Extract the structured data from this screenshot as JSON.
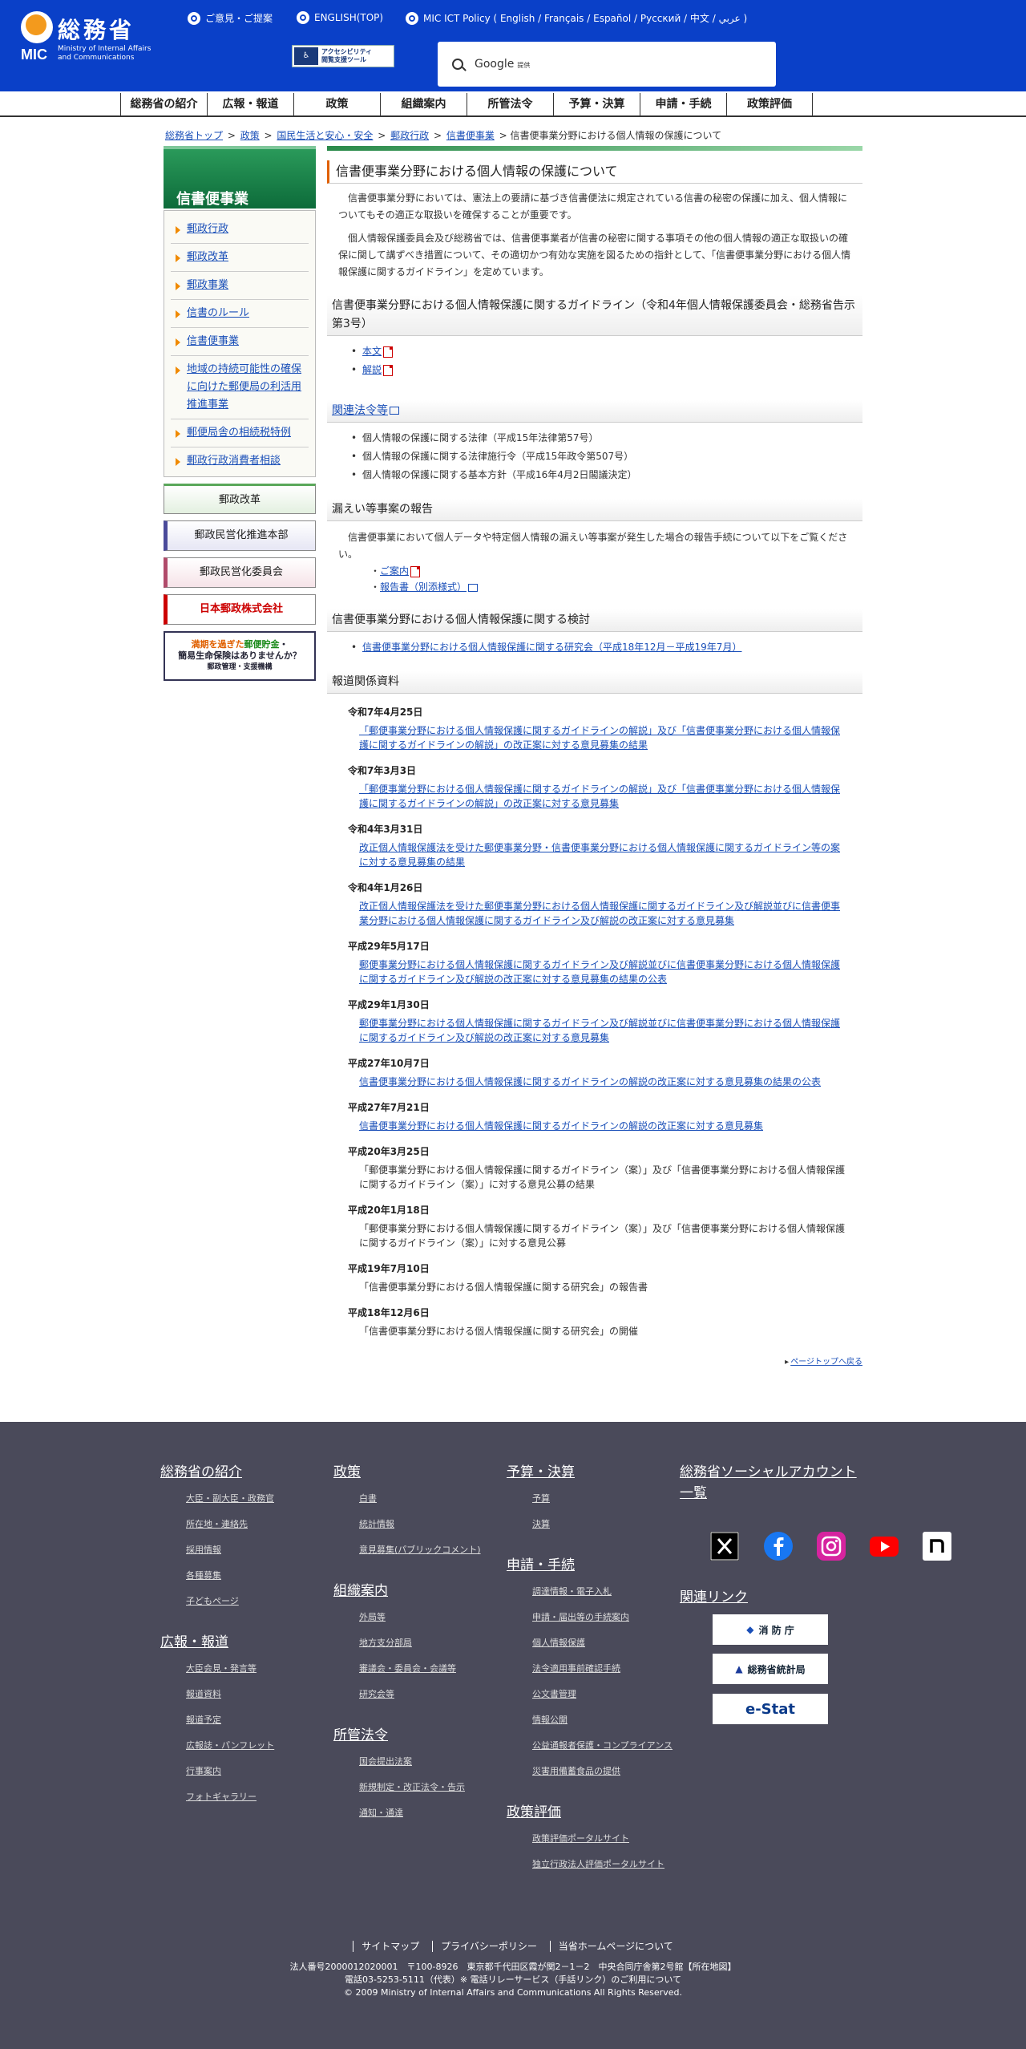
{
  "header": {
    "logo_kanji": "総務省",
    "logo_mic": "MIC",
    "logo_en1": "Ministry of Internal Affairs",
    "logo_en2": "and Communications",
    "links": [
      "ご意見・ご提案",
      "ENGLISH(TOP)",
      "MIC ICT Policy ( English / Français / Español / Русский / 中文 / عربي )"
    ],
    "accessibility_line1": "アクセシビリティ",
    "accessibility_line2": "閲覧支援ツール",
    "search_brand": "Google",
    "search_sub": "提供"
  },
  "gnav": [
    "総務省の紹介",
    "広報・報道",
    "政策",
    "組織案内",
    "所管法令",
    "予算・決算",
    "申請・手続",
    "政策評価"
  ],
  "breadcrumb": {
    "items": [
      "総務省トップ",
      "政策",
      "国民生活と安心・安全",
      "郵政行政",
      "信書便事業"
    ],
    "current": "信書便事業分野における個人情報の保護について"
  },
  "sidebar": {
    "title": "信書便事業",
    "items": [
      "郵政行政",
      "郵政改革",
      "郵政事業",
      "信書のルール",
      "信書便事業",
      "地域の持続可能性の確保に向けた郵便局の利活用推進事業",
      "郵便局舎の相続税特例",
      "郵政行政消費者相談"
    ],
    "buttons": [
      "郵政改革",
      "郵政民営化推進本部",
      "郵政民営化委員会",
      "日本郵政株式会社"
    ],
    "banner": {
      "l1a": "満期を過ぎた",
      "l1b": "郵便貯金",
      "l1c": "・",
      "l2": "簡易生命保険はありませんか？",
      "l3": "郵政管理・支援機構"
    }
  },
  "main": {
    "title": "信書便事業分野における個人情報の保護について",
    "p1": "信書便事業分野においては、憲法上の要請に基づき信書便法に規定されている信書の秘密の保護に加え、個人情報についてもその適正な取扱いを確保することが重要です。",
    "p2": "個人情報保護委員会及び総務省では、信書便事業者が信書の秘密に関する事項その他の個人情報の適正な取扱いの確保に関して講ずべき措置について、その適切かつ有効な実施を図るための指針として、「信書便事業分野における個人情報保護に関するガイドライン」を定めています。",
    "s1": "信書便事業分野における個人情報保護に関するガイドライン（令和4年個人情報保護委員会・総務省告示第3号）",
    "s1_links": [
      "本文",
      "解説"
    ],
    "s2": "関連法令等",
    "s2_items": [
      "個人情報の保護に関する法律（平成15年法律第57号）",
      "個人情報の保護に関する法律施行令（平成15年政令第507号）",
      "個人情報の保護に関する基本方針（平成16年4月2日閣議決定）"
    ],
    "s3": "漏えい等事案の報告",
    "s3_text": "信書便事業において個人データや特定個人情報の漏えい等事案が発生した場合の報告手続について以下をご覧ください。",
    "s3_links": [
      "ご案内",
      "報告書（別添様式）"
    ],
    "s4": "信書便事業分野における個人情報保護に関する検討",
    "s4_link": "信書便事業分野における個人情報保護に関する研究会（平成18年12月－平成19年7月）",
    "s5": "報道関係資料",
    "press": [
      {
        "date": "令和7年4月25日",
        "text": "「郵便事業分野における個人情報保護に関するガイドラインの解説」及び「信書便事業分野における個人情報保護に関するガイドラインの解説」の改正案に対する意見募集の結果",
        "link": true
      },
      {
        "date": "令和7年3月3日",
        "text": "「郵便事業分野における個人情報保護に関するガイドラインの解説」及び「信書便事業分野における個人情報保護に関するガイドラインの解説」の改正案に対する意見募集",
        "link": true
      },
      {
        "date": "令和4年3月31日",
        "text": "改正個人情報保護法を受けた郵便事業分野・信書便事業分野における個人情報保護に関するガイドライン等の案に対する意見募集の結果",
        "link": true
      },
      {
        "date": "令和4年1月26日",
        "text": "改正個人情報保護法を受けた郵便事業分野における個人情報保護に関するガイドライン及び解説並びに信書便事業分野における個人情報保護に関するガイドライン及び解説の改正案に対する意見募集",
        "link": true
      },
      {
        "date": "平成29年5月17日",
        "text": "郵便事業分野における個人情報保護に関するガイドライン及び解説並びに信書便事業分野における個人情報保護に関するガイドライン及び解説の改正案に対する意見募集の結果の公表",
        "link": true
      },
      {
        "date": "平成29年1月30日",
        "text": "郵便事業分野における個人情報保護に関するガイドライン及び解説並びに信書便事業分野における個人情報保護に関するガイドライン及び解説の改正案に対する意見募集",
        "link": true
      },
      {
        "date": "平成27年10月7日",
        "text": "信書便事業分野における個人情報保護に関するガイドラインの解説の改正案に対する意見募集の結果の公表",
        "link": true
      },
      {
        "date": "平成27年7月21日",
        "text": "信書便事業分野における個人情報保護に関するガイドラインの解説の改正案に対する意見募集",
        "link": true
      },
      {
        "date": "平成20年3月25日",
        "text": "「郵便事業分野における個人情報保護に関するガイドライン（案）」及び「信書便事業分野における個人情報保護に関するガイドライン（案）」に対する意見公募の結果",
        "link": false
      },
      {
        "date": "平成20年1月18日",
        "text": "「郵便事業分野における個人情報保護に関するガイドライン（案）」及び「信書便事業分野における個人情報保護に関するガイドライン（案）」に対する意見公募",
        "link": false
      },
      {
        "date": "平成19年7月10日",
        "text": "「信書便事業分野における個人情報保護に関する研究会」の報告書",
        "link": false
      },
      {
        "date": "平成18年12月6日",
        "text": "「信書便事業分野における個人情報保護に関する研究会」の開催",
        "link": false
      }
    ],
    "pagetop": "ページトップへ戻る"
  },
  "footer": {
    "c1h": "総務省の紹介",
    "c1": [
      "大臣・副大臣・政務官",
      "所在地・連絡先",
      "採用情報",
      "各種募集",
      "子どもページ"
    ],
    "c1bh": "広報・報道",
    "c1b": [
      "大臣会見・発言等",
      "報道資料",
      "報道予定",
      "広報誌・パンフレット",
      "行事案内",
      "フォトギャラリー"
    ],
    "c2h": "政策",
    "c2": [
      "白書",
      "統計情報",
      "意見募集(パブリックコメント)"
    ],
    "c2bh": "組織案内",
    "c2b": [
      "外局等",
      "地方支分部局",
      "審議会・委員会・会議等",
      "研究会等"
    ],
    "c2ch": "所管法令",
    "c2c": [
      "国会提出法案",
      "新規制定・改正法令・告示",
      "通知・通達"
    ],
    "c3h": "予算・決算",
    "c3": [
      "予算",
      "決算"
    ],
    "c3bh": "申請・手続",
    "c3b": [
      "調達情報・電子入札",
      "申請・届出等の手続案内",
      "個人情報保護",
      "法令適用事前確認手続",
      "公文書管理",
      "情報公開",
      "公益通報者保護・コンプライアンス",
      "災害用備蓄食品の提供"
    ],
    "c3ch": "政策評価",
    "c3c": [
      "政策評価ポータルサイト",
      "独立行政法人評価ポータルサイト"
    ],
    "c4h": "総務省ソーシャルアカウント一覧",
    "c4bh": "関連リンク",
    "related": [
      "消 防 庁",
      "総務省統計局",
      "e-Stat"
    ],
    "links": [
      "サイトマップ",
      "プライバシーポリシー",
      "当省ホームページについて"
    ],
    "addr": "法人番号2000012020001　〒100-8926　東京都千代田区霞が関2－1－2　中央合同庁舎第2号館【所在地図】",
    "tel": "電話03-5253-5111（代表）※ 電話リレーサービス（手話リンク）のご利用について",
    "copy": "© 2009 Ministry of Internal Affairs and Communications All Rights Reserved."
  }
}
